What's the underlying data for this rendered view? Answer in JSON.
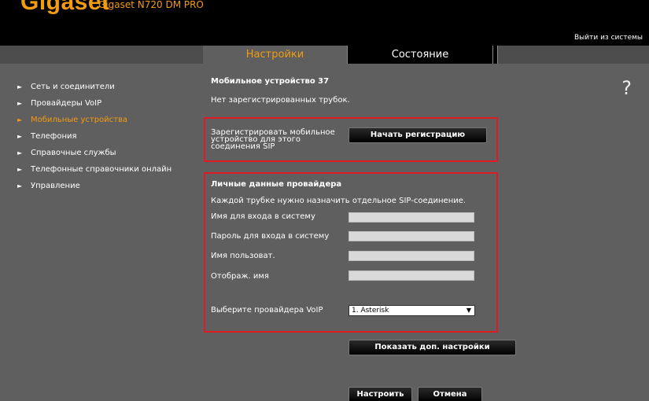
{
  "header": {
    "brand": "Gigaset",
    "model": "Gigaset N720 DM PRO",
    "logout": "Выйти из системы"
  },
  "tabs": [
    {
      "label": "Настройки",
      "active": true
    },
    {
      "label": "Состояние",
      "active": false
    }
  ],
  "sidebar": {
    "items": [
      {
        "label": "Сеть и соединители"
      },
      {
        "label": "Провайдеры VoIP"
      },
      {
        "label": "Мобильные устройства",
        "active": true
      },
      {
        "label": "Телефония"
      },
      {
        "label": "Справочные службы"
      },
      {
        "label": "Телефонные справочники онлайн"
      },
      {
        "label": "Управление"
      }
    ]
  },
  "main": {
    "title": "Мобильное устройство 37",
    "no_handsets": "Нет зарегистрированных трубок.",
    "help": "?",
    "register": {
      "label_line1": "Зарегистрировать мобильное",
      "label_line2": "устройство для этого",
      "label_line3": "соединения SIP",
      "button": "Начать регистрацию"
    },
    "provider": {
      "title": "Личные данные провайдера",
      "hint": "Каждой трубке нужно назначить отдельное SIP-соединение.",
      "fields": [
        {
          "label": "Имя для входа в систему",
          "value": ""
        },
        {
          "label": "Пароль для входа в систему",
          "value": ""
        },
        {
          "label": "Имя пользоват.",
          "value": ""
        },
        {
          "label": "Отображ. имя",
          "value": ""
        }
      ],
      "voip_label": "Выберите провайдера VoIP",
      "voip_selected": "1. Asterisk"
    },
    "advanced_button": "Показать доп. настройки",
    "save_button": "Настроить",
    "cancel_button": "Отмена"
  },
  "colors": {
    "accent": "#f39c12",
    "highlight_box": "#e01b24",
    "background": "#5f5f5f"
  }
}
